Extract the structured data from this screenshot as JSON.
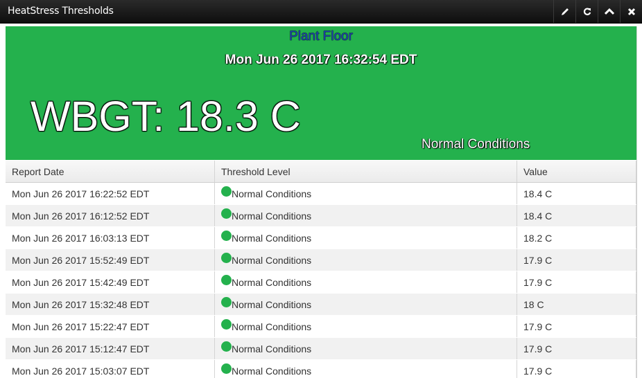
{
  "window": {
    "title": "HeatStress Thresholds",
    "buttons": [
      {
        "name": "edit",
        "icon": "pencil-icon"
      },
      {
        "name": "refresh",
        "icon": "refresh-icon"
      },
      {
        "name": "collapse",
        "icon": "chevron-up-icon"
      },
      {
        "name": "close",
        "icon": "close-icon"
      }
    ]
  },
  "banner": {
    "location": "Plant Floor",
    "timestamp": "Mon Jun 26 2017 16:32:54 EDT",
    "reading": "WBGT: 18.3 C",
    "condition": "Normal Conditions",
    "color": "#24b14d"
  },
  "table": {
    "headers": [
      "Report Date",
      "Threshold Level",
      "Value"
    ],
    "rows": [
      {
        "date": "Mon Jun 26 2017 16:22:52 EDT",
        "level": "Normal Conditions",
        "value": "18.4 C"
      },
      {
        "date": "Mon Jun 26 2017 16:12:52 EDT",
        "level": "Normal Conditions",
        "value": "18.4 C"
      },
      {
        "date": "Mon Jun 26 2017 16:03:13 EDT",
        "level": "Normal Conditions",
        "value": "18.2 C"
      },
      {
        "date": "Mon Jun 26 2017 15:52:49 EDT",
        "level": "Normal Conditions",
        "value": "17.9 C"
      },
      {
        "date": "Mon Jun 26 2017 15:42:49 EDT",
        "level": "Normal Conditions",
        "value": "17.9 C"
      },
      {
        "date": "Mon Jun 26 2017 15:32:48 EDT",
        "level": "Normal Conditions",
        "value": "18 C"
      },
      {
        "date": "Mon Jun 26 2017 15:22:47 EDT",
        "level": "Normal Conditions",
        "value": "17.9 C"
      },
      {
        "date": "Mon Jun 26 2017 15:12:47 EDT",
        "level": "Normal Conditions",
        "value": "17.9 C"
      },
      {
        "date": "Mon Jun 26 2017 15:03:07 EDT",
        "level": "Normal Conditions",
        "value": "17.9 C"
      }
    ]
  }
}
